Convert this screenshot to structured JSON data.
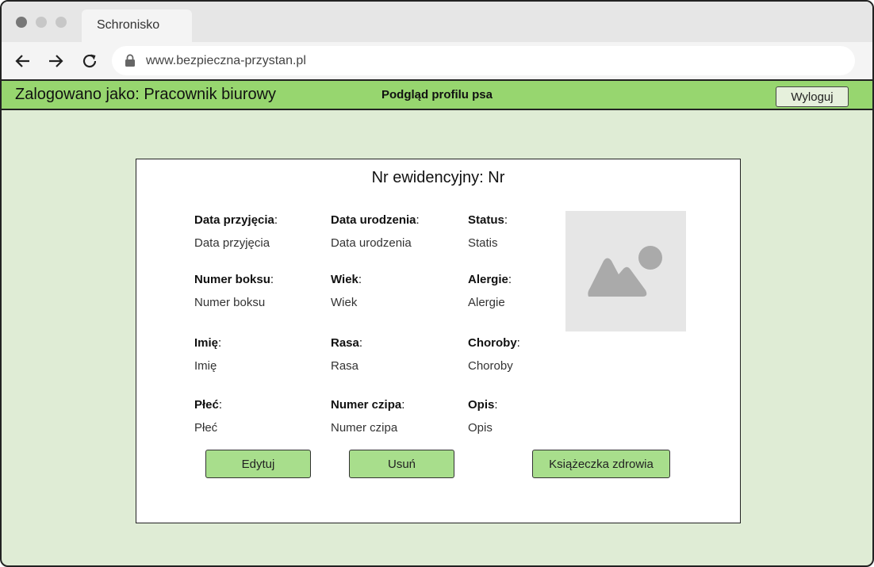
{
  "browser": {
    "tab_title": "Schronisko",
    "url": "www.bezpieczna-przystan.pl"
  },
  "header": {
    "user_label": "Zalogowano jako: Pracownik biurowy",
    "page_title": "Podgląd profilu psa",
    "logout_label": "Wyloguj"
  },
  "profile": {
    "title": "Nr ewidencyjny: Nr",
    "fields": [
      {
        "label": "Data przyjęcia",
        "value": "Data przyjęcia"
      },
      {
        "label": "Data urodzenia",
        "value": "Data urodzenia"
      },
      {
        "label": "Status",
        "value": "Statis"
      },
      {
        "label": "Numer boksu",
        "value": "Numer boksu"
      },
      {
        "label": "Wiek",
        "value": "Wiek"
      },
      {
        "label": "Alergie",
        "value": "Alergie"
      },
      {
        "label": "Imię",
        "value": "Imię"
      },
      {
        "label": "Rasa",
        "value": "Rasa"
      },
      {
        "label": "Choroby",
        "value": "Choroby"
      },
      {
        "label": "Płeć",
        "value": "Płeć"
      },
      {
        "label": "Numer czipa",
        "value": "Numer czipa"
      },
      {
        "label": "Opis",
        "value": "Opis"
      }
    ],
    "label_suffix": ":"
  },
  "actions": {
    "edit_label": "Edytuj",
    "delete_label": "Usuń",
    "health_book_label": "Książeczka zdrowia"
  },
  "icons": {
    "back": "arrow-left-icon",
    "forward": "arrow-right-icon",
    "reload": "reload-icon",
    "lock": "lock-icon",
    "photo": "image-placeholder-icon"
  },
  "colors": {
    "app_bar": "#97d66f",
    "page_background": "#dfecd5",
    "button": "#a8de8c"
  }
}
